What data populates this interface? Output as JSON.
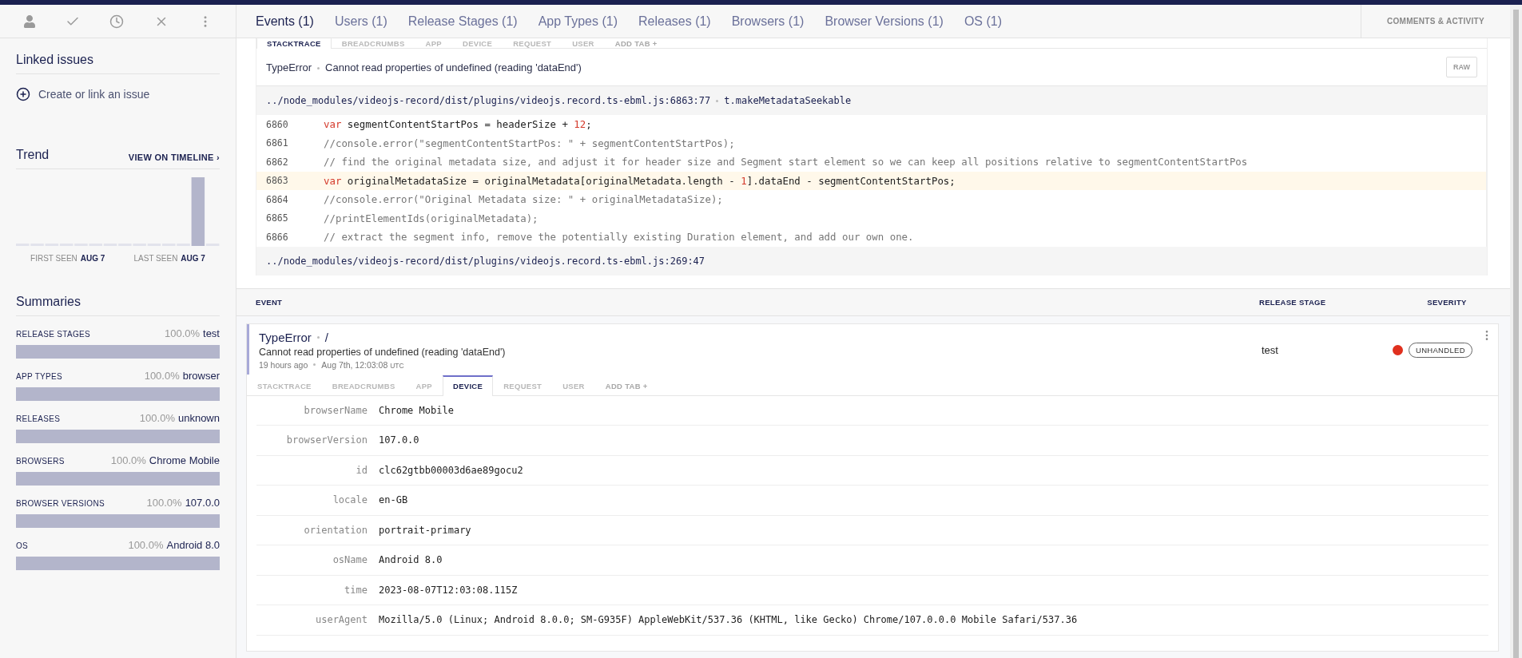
{
  "sidebar": {
    "linked_issues": {
      "title": "Linked issues",
      "action": "Create or link an issue"
    },
    "trend": {
      "title": "Trend",
      "link": "VIEW ON TIMELINE ›",
      "first_seen_label": "FIRST SEEN",
      "first_seen": "AUG 7",
      "last_seen_label": "LAST SEEN",
      "last_seen": "AUG 7"
    },
    "summaries": {
      "title": "Summaries",
      "items": [
        {
          "label": "RELEASE STAGES",
          "percent": "100.0%",
          "value": "test",
          "level": 1
        },
        {
          "label": "APP TYPES",
          "percent": "100.0%",
          "value": "browser",
          "level": 1
        },
        {
          "label": "RELEASES",
          "percent": "100.0%",
          "value": "unknown",
          "level": 1
        },
        {
          "label": "BROWSERS",
          "percent": "100.0%",
          "value": "Chrome Mobile",
          "level": 1
        },
        {
          "label": "BROWSER VERSIONS",
          "percent": "100.0%",
          "value": "107.0.0",
          "level": 1
        },
        {
          "label": "OS",
          "percent": "100.0%",
          "value": "Android 8.0",
          "level": 1
        }
      ]
    }
  },
  "tabs": [
    {
      "label": "Events (1)",
      "selected": true
    },
    {
      "label": "Users (1)",
      "selected": false
    },
    {
      "label": "Release Stages (1)",
      "selected": false
    },
    {
      "label": "App Types (1)",
      "selected": false
    },
    {
      "label": "Releases (1)",
      "selected": false
    },
    {
      "label": "Browsers (1)",
      "selected": false
    },
    {
      "label": "Browser Versions (1)",
      "selected": false
    },
    {
      "label": "OS (1)",
      "selected": false
    }
  ],
  "comments_tab": "COMMENTS & ACTIVITY",
  "stacktrace_panel": {
    "tabs": [
      {
        "label": "STACKTRACE",
        "selected": true
      },
      {
        "label": "BREADCRUMBS",
        "selected": false
      },
      {
        "label": "APP",
        "selected": false
      },
      {
        "label": "DEVICE",
        "selected": false
      },
      {
        "label": "REQUEST",
        "selected": false
      },
      {
        "label": "USER",
        "selected": false
      }
    ],
    "add_tab": "ADD TAB +",
    "error_class": "TypeError",
    "error_message": "Cannot read properties of undefined (reading 'dataEnd')",
    "raw_button": "RAW",
    "frames": [
      {
        "file": "../node_modules/videojs-record/dist/plugins/videojs.record.ts-ebml.js:6863:77",
        "method": "t.makeMetadataSeekable",
        "lines": [
          {
            "number": "6860",
            "highlighted": false,
            "parts": [
              {
                "kind": "keyword",
                "text": "var"
              },
              {
                "kind": "plain",
                "text": " segmentContentStartPos = headerSize + "
              },
              {
                "kind": "number",
                "text": "12"
              },
              {
                "kind": "plain",
                "text": ";"
              }
            ]
          },
          {
            "number": "6861",
            "highlighted": false,
            "parts": [
              {
                "kind": "comment",
                "text": "//console.error(\"segmentContentStartPos: \" + segmentContentStartPos);"
              }
            ]
          },
          {
            "number": "6862",
            "highlighted": false,
            "parts": [
              {
                "kind": "comment",
                "text": "// find the original metadata size, and adjust it for header size and Segment start element so we can keep all positions relative to segmentContentStartPos"
              }
            ]
          },
          {
            "number": "6863",
            "highlighted": true,
            "parts": [
              {
                "kind": "keyword",
                "text": "var"
              },
              {
                "kind": "plain",
                "text": " originalMetadataSize = originalMetadata[originalMetadata.length - "
              },
              {
                "kind": "number",
                "text": "1"
              },
              {
                "kind": "plain",
                "text": "].dataEnd - segmentContentStartPos;"
              }
            ]
          },
          {
            "number": "6864",
            "highlighted": false,
            "parts": [
              {
                "kind": "comment",
                "text": "//console.error(\"Original Metadata size: \" + originalMetadataSize);"
              }
            ]
          },
          {
            "number": "6865",
            "highlighted": false,
            "parts": [
              {
                "kind": "comment",
                "text": "//printElementIds(originalMetadata);"
              }
            ]
          },
          {
            "number": "6866",
            "highlighted": false,
            "parts": [
              {
                "kind": "comment",
                "text": "// extract the segment info, remove the potentially existing Duration element, and add our own one."
              }
            ]
          }
        ]
      },
      {
        "file": "../node_modules/videojs-record/dist/plugins/videojs.record.ts-ebml.js:269:47"
      }
    ]
  },
  "events_table": {
    "columns": [
      "EVENT",
      "RELEASE STAGE",
      "SEVERITY"
    ],
    "event": {
      "error_class": "TypeError",
      "context": "/",
      "message": "Cannot read properties of undefined (reading 'dataEnd')",
      "relative_time": "19 hours ago",
      "timestamp": "Aug 7th, 12:03:08",
      "timezone": "UTC",
      "release_stage": "test",
      "handled_badge": "UNHANDLED",
      "tabs": [
        {
          "label": "STACKTRACE",
          "selected": false
        },
        {
          "label": "BREADCRUMBS",
          "selected": false
        },
        {
          "label": "APP",
          "selected": false
        },
        {
          "label": "DEVICE",
          "selected": true
        },
        {
          "label": "REQUEST",
          "selected": false
        },
        {
          "label": "USER",
          "selected": false
        }
      ],
      "add_tab": "ADD TAB +",
      "device": [
        {
          "key": "browserName",
          "value": "Chrome Mobile"
        },
        {
          "key": "browserVersion",
          "value": "107.0.0"
        },
        {
          "key": "id",
          "value": "clc62gtbb00003d6ae89gocu2"
        },
        {
          "key": "locale",
          "value": "en-GB"
        },
        {
          "key": "orientation",
          "value": "portrait-primary"
        },
        {
          "key": "osName",
          "value": "Android 8.0"
        },
        {
          "key": "time",
          "value": "2023-08-07T12:03:08.115Z"
        },
        {
          "key": "userAgent",
          "value": "Mozilla/5.0 (Linux; Android 8.0.0; SM-G935F) AppleWebKit/537.36 (KHTML, like Gecko) Chrome/107.0.0.0 Mobile Safari/537.36"
        }
      ]
    }
  }
}
